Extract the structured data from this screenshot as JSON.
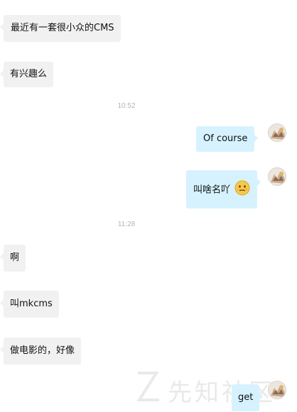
{
  "messages": [
    {
      "side": "left",
      "text": "最近有一套很小众的CMS"
    },
    {
      "side": "left",
      "text": "有兴趣么"
    },
    {
      "side": "right",
      "text": "Of  course"
    },
    {
      "side": "right",
      "text": "叫啥名吖"
    },
    {
      "side": "left",
      "text": "啊"
    },
    {
      "side": "left",
      "text": "叫mkcms"
    },
    {
      "side": "left",
      "text": "做电影的，好像"
    },
    {
      "side": "right",
      "text": "get"
    }
  ],
  "timestamps": [
    "10:52",
    "11:28"
  ],
  "emoji": {
    "icon": "thinking-face-emoji",
    "color": "#f7c948"
  },
  "watermark": {
    "text": "先知社区"
  },
  "colors": {
    "left_bubble": "#f1f1f1",
    "right_bubble": "#d6f2ff",
    "timestamp": "#b4b4b4"
  }
}
